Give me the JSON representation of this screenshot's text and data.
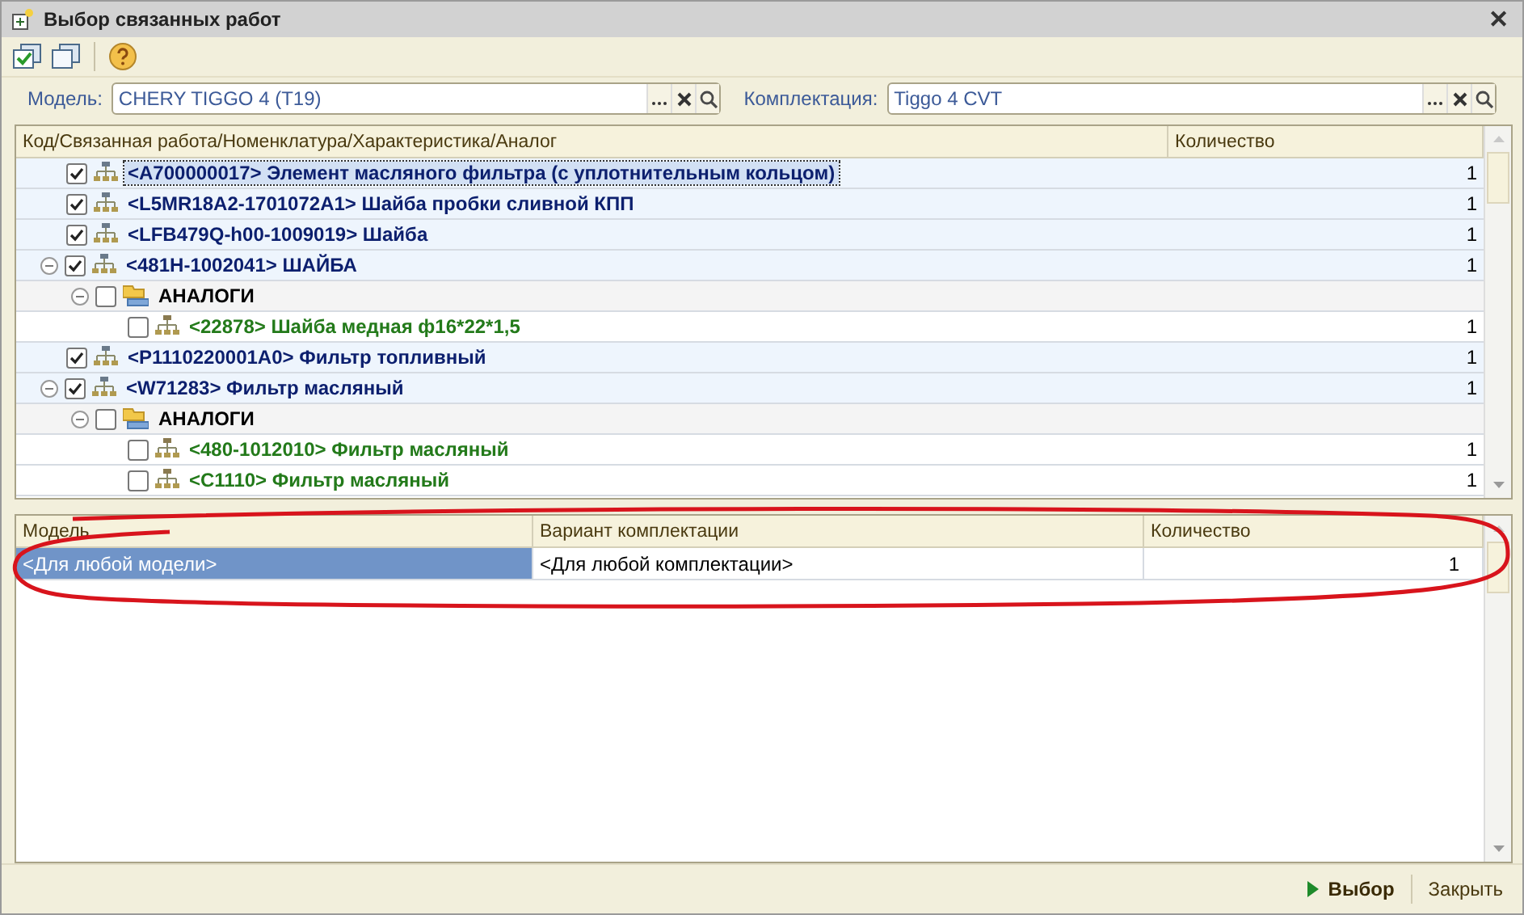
{
  "window": {
    "title": "Выбор связанных работ",
    "close": "✕"
  },
  "toolbar": {
    "items": [
      {
        "kind": "check_all"
      },
      {
        "kind": "uncheck_all"
      },
      {
        "kind": "help"
      }
    ]
  },
  "filters": [
    {
      "label": "Модель:",
      "value": "CHERY TIGGO 4 (T19)"
    },
    {
      "label": "Комплектация:",
      "value": "Tiggo 4 CVT"
    }
  ],
  "tree": {
    "columns": [
      "Код/Связанная работа/Номенклатура/Характеристика/Аналог",
      "Количество"
    ],
    "rows": [
      {
        "kind": "work",
        "text": "<A700000017> Элемент масляного фильтра (с уплотнительным кольцом)",
        "quantity": "1",
        "checked": true,
        "selected": true
      },
      {
        "kind": "work",
        "text": "<L5MR18A2-1701072A1> Шайба пробки сливной КПП",
        "quantity": "1",
        "checked": true,
        "selected": false
      },
      {
        "kind": "work",
        "text": "<LFB479Q-h00-1009019> Шайба",
        "quantity": "1",
        "checked": true,
        "selected": false
      },
      {
        "kind": "work",
        "text": "<481H-1002041> ШАЙБА",
        "quantity": "1",
        "checked": true,
        "selected": false,
        "expanded": true,
        "children": [
          {
            "kind": "group",
            "text": "АНАЛОГИ",
            "checked": false,
            "selected": false,
            "expanded": true,
            "children": [
              {
                "kind": "analog",
                "text": "<22878> Шайба медная ф16*22*1,5",
                "quantity": "1",
                "checked": false,
                "selected": false
              }
            ]
          }
        ]
      },
      {
        "kind": "work",
        "text": "<P1110220001A0> Фильтр топливный",
        "quantity": "1",
        "checked": true,
        "selected": false
      },
      {
        "kind": "work",
        "text": "<W71283> Фильтр масляный",
        "quantity": "1",
        "checked": true,
        "selected": false,
        "expanded": true,
        "children": [
          {
            "kind": "group",
            "text": "АНАЛОГИ",
            "checked": false,
            "selected": false,
            "expanded": true,
            "children": [
              {
                "kind": "analog",
                "text": "<480-1012010> Фильтр масляный",
                "quantity": "1",
                "checked": false,
                "selected": false
              },
              {
                "kind": "analog",
                "text": "<C1110> Фильтр масляный",
                "quantity": "1",
                "checked": false,
                "selected": false
              }
            ]
          }
        ]
      }
    ]
  },
  "variants": {
    "columns": [
      "Модель",
      "Вариант комплектации",
      "Количество"
    ],
    "rows": [
      {
        "cells": [
          "<Для любой модели>",
          "<Для любой комплектации>",
          "1"
        ],
        "selected": true
      }
    ]
  },
  "footer": {
    "buttons": [
      {
        "label": "Выбор",
        "default": true
      },
      {
        "label": "Закрыть",
        "default": false
      }
    ]
  }
}
